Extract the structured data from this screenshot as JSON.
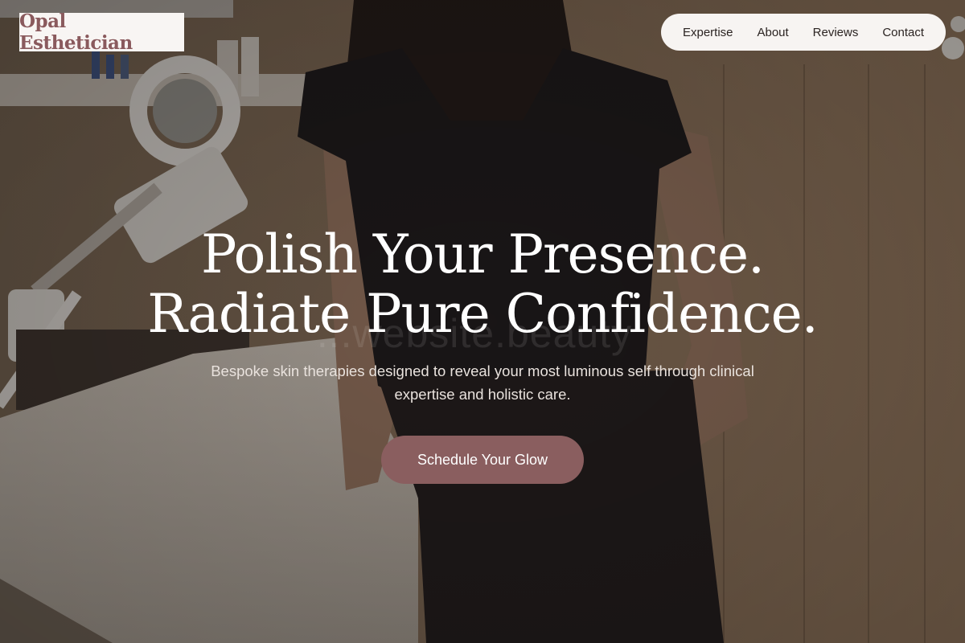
{
  "brand": {
    "name": "Opal Esthetician"
  },
  "nav": {
    "items": [
      "Expertise",
      "About",
      "Reviews",
      "Contact"
    ]
  },
  "hero": {
    "headline_line1": "Polish Your Presence.",
    "headline_line2": "Radiate Pure Confidence.",
    "subtitle": "Bespoke skin therapies designed to reveal your most luminous self through clinical expertise and holistic care.",
    "cta_label": "Schedule Your Glow",
    "watermark": "...website.beauty"
  },
  "colors": {
    "brand_text": "#8a5a5d",
    "cta_background": "#8a5e5f",
    "nav_background": "#f7f4f2"
  }
}
